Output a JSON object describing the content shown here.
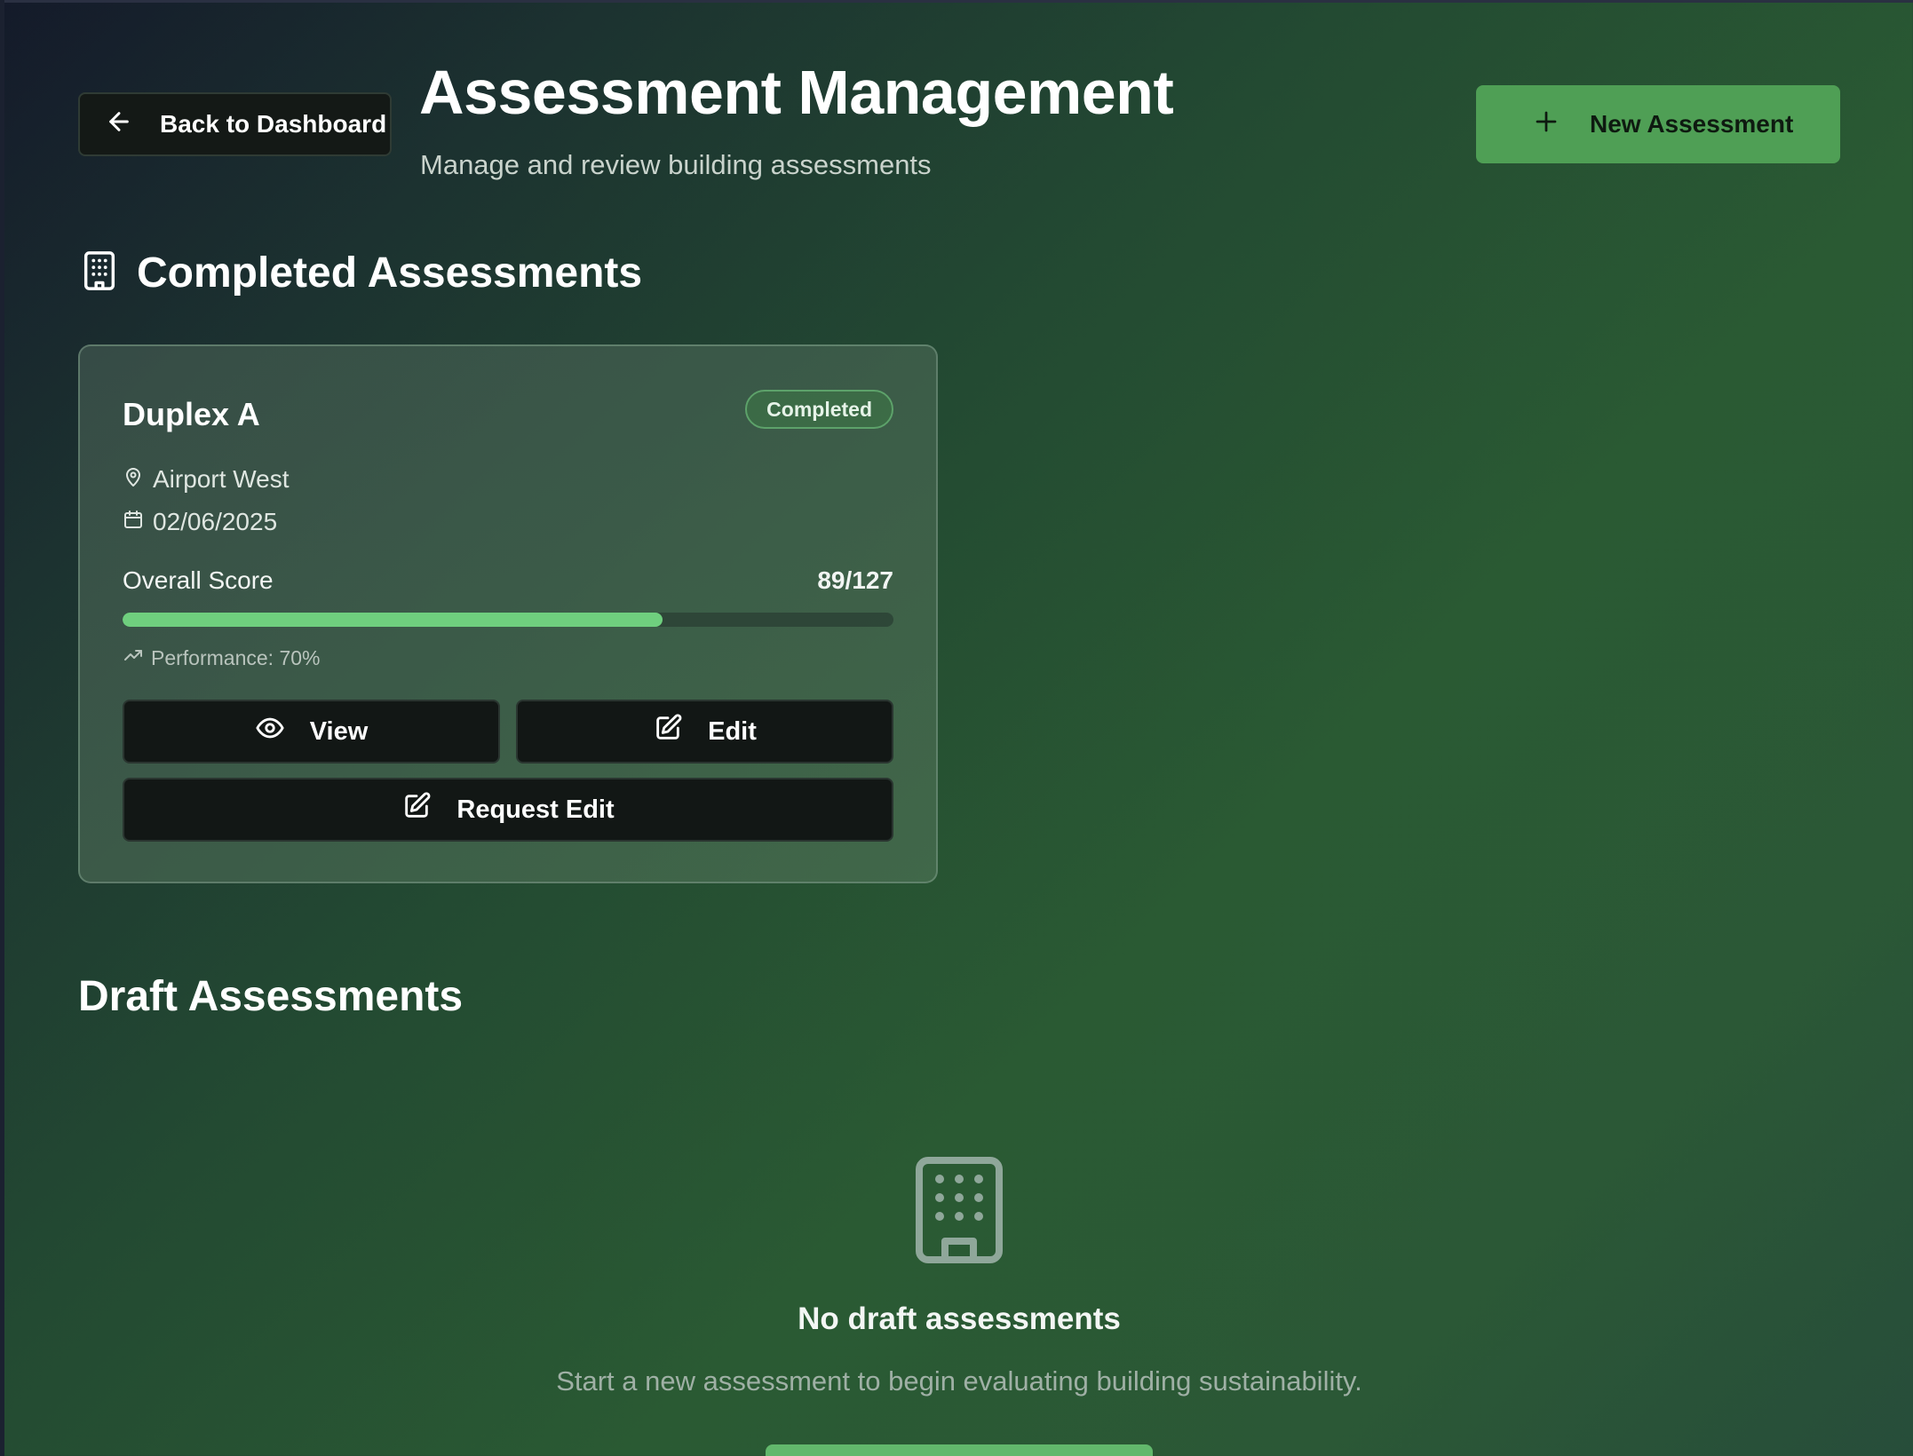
{
  "header": {
    "back_label": "Back to Dashboard",
    "title": "Assessment Management",
    "subtitle": "Manage and review building assessments",
    "new_label": "New Assessment"
  },
  "completed": {
    "section_title": "Completed Assessments",
    "card": {
      "name": "Duplex A",
      "status": "Completed",
      "location": "Airport West",
      "date": "02/06/2025",
      "score_label": "Overall Score",
      "score_value": "89/127",
      "progress_fraction": 0.7,
      "performance": "Performance: 70%",
      "view_label": "View",
      "edit_label": "Edit",
      "request_label": "Request Edit"
    }
  },
  "drafts": {
    "section_title": "Draft Assessments",
    "empty_title": "No draft assessments",
    "empty_text": "Start a new assessment to begin evaluating building sustainability."
  },
  "colors": {
    "accent": "#4f9f55",
    "progress": "#6fcf7e",
    "button_dark": "#121715"
  },
  "icons": [
    "arrow-left-icon",
    "plus-icon",
    "building-icon",
    "map-pin-icon",
    "calendar-icon",
    "trending-up-icon",
    "eye-icon",
    "edit-icon"
  ]
}
